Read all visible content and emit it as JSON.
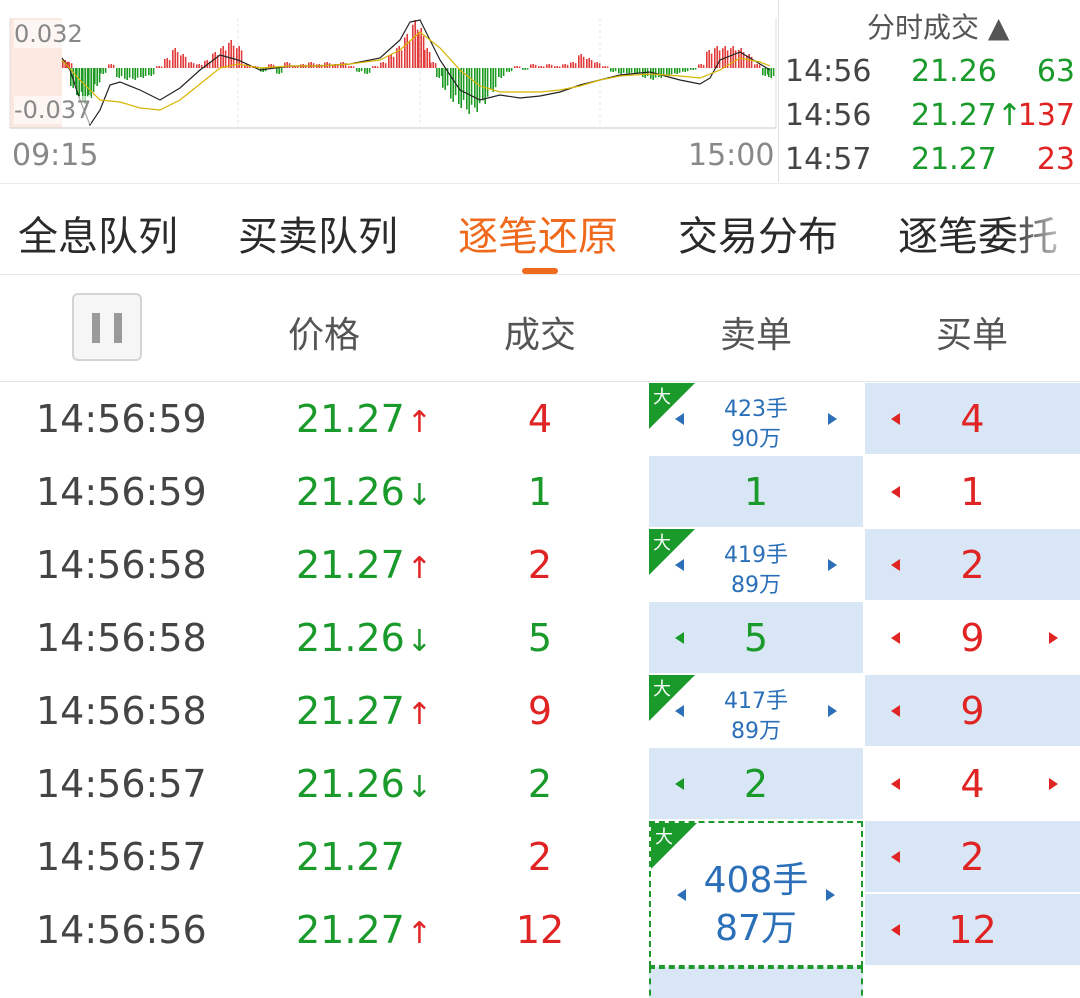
{
  "chart": {
    "y_top": "0.032",
    "y_bottom": "-0.037",
    "x_start": "09:15",
    "x_end": "15:00"
  },
  "ticks_panel": {
    "title": "分时成交 ▲",
    "rows": [
      {
        "time": "14:56",
        "price": "21.26",
        "vol": "63",
        "vol_color": "#1a9a2a"
      },
      {
        "time": "14:56",
        "price": "21.27↑",
        "vol": "137",
        "vol_color": "#e02424"
      },
      {
        "time": "14:57",
        "price": "21.27",
        "vol": "23",
        "vol_color": "#e02424"
      }
    ]
  },
  "tabs": [
    "全息队列",
    "买卖队列",
    "逐笔还原",
    "交易分布",
    "逐笔委托"
  ],
  "header": {
    "price": "价格",
    "volume": "成交",
    "sell": "卖单",
    "buy": "买单"
  },
  "big_badge": "大",
  "rows": [
    {
      "time": "14:56:59",
      "price": "21.27",
      "dir": "↑",
      "vol": "4",
      "sell": {
        "kind": "big",
        "l1": "423手",
        "l2": "90万"
      },
      "buy": "4"
    },
    {
      "time": "14:56:59",
      "price": "21.26",
      "dir": "↓",
      "vol": "1",
      "sell": {
        "kind": "plain",
        "num": "1"
      },
      "buy": "1"
    },
    {
      "time": "14:56:58",
      "price": "21.27",
      "dir": "↑",
      "vol": "2",
      "sell": {
        "kind": "big",
        "l1": "419手",
        "l2": "89万"
      },
      "buy": "2"
    },
    {
      "time": "14:56:58",
      "price": "21.26",
      "dir": "↓",
      "vol": "5",
      "sell": {
        "kind": "plain",
        "num": "5"
      },
      "buy": "9"
    },
    {
      "time": "14:56:58",
      "price": "21.27",
      "dir": "↑",
      "vol": "9",
      "sell": {
        "kind": "big",
        "l1": "417手",
        "l2": "89万"
      },
      "buy": "9"
    },
    {
      "time": "14:56:57",
      "price": "21.26",
      "dir": "↓",
      "vol": "2",
      "sell": {
        "kind": "plain",
        "num": "2"
      },
      "buy": "4"
    },
    {
      "time": "14:56:57",
      "price": "21.27",
      "dir": "",
      "vol": "2",
      "sell": {
        "kind": "dashed",
        "l1": "408手",
        "l2": "87万"
      },
      "buy": "2"
    },
    {
      "time": "14:56:56",
      "price": "21.27",
      "dir": "↑",
      "vol": "12",
      "sell": {
        "kind": "dashed-cont"
      },
      "buy": "12"
    }
  ],
  "colors": {
    "up_red": "#e02424",
    "down_green": "#1a9a2a",
    "accent_orange": "#f06a1e",
    "sell_blue": "#2a6fb8",
    "cell_bg": "#d9e6f5"
  }
}
